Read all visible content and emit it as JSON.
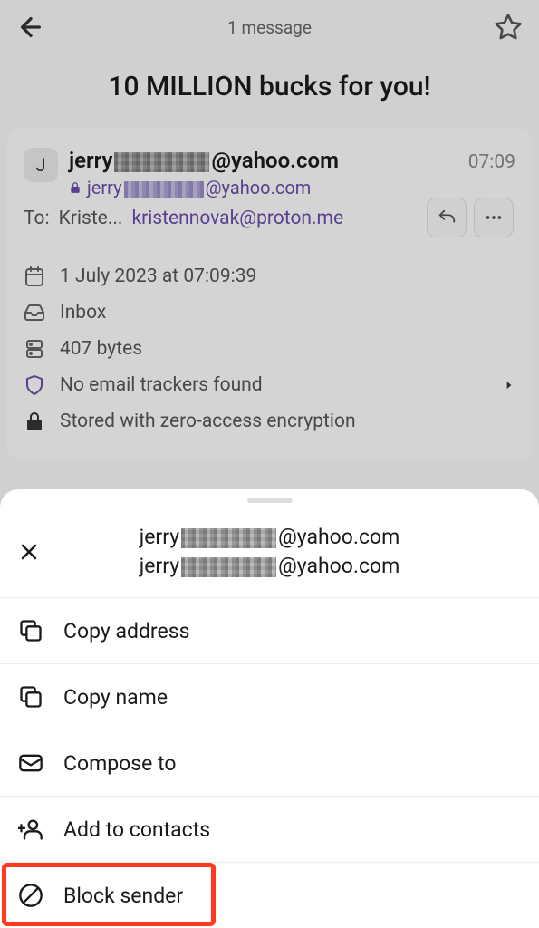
{
  "header": {
    "message_count": "1 message"
  },
  "subject": "10 MILLION bucks for you!",
  "message": {
    "avatar_initial": "J",
    "sender_prefix": "jerry",
    "sender_suffix": "@yahoo.com",
    "time": "07:09",
    "sender_email_prefix": "jerry",
    "sender_email_suffix": "@yahoo.com",
    "to_label": "To:",
    "to_name": "Kriste...",
    "to_email": "kristennovak@proton.me",
    "date": "1 July 2023 at 07:09:39",
    "folder": "Inbox",
    "size": "407 bytes",
    "trackers": "No email trackers found",
    "encryption": "Stored with zero-access encryption"
  },
  "sheet": {
    "email1_prefix": "jerry",
    "email1_suffix": "@yahoo.com",
    "email2_prefix": "jerry",
    "email2_suffix": "@yahoo.com",
    "menu": {
      "copy_address": "Copy address",
      "copy_name": "Copy name",
      "compose_to": "Compose to",
      "add_contacts": "Add to contacts",
      "block_sender": "Block sender"
    }
  }
}
